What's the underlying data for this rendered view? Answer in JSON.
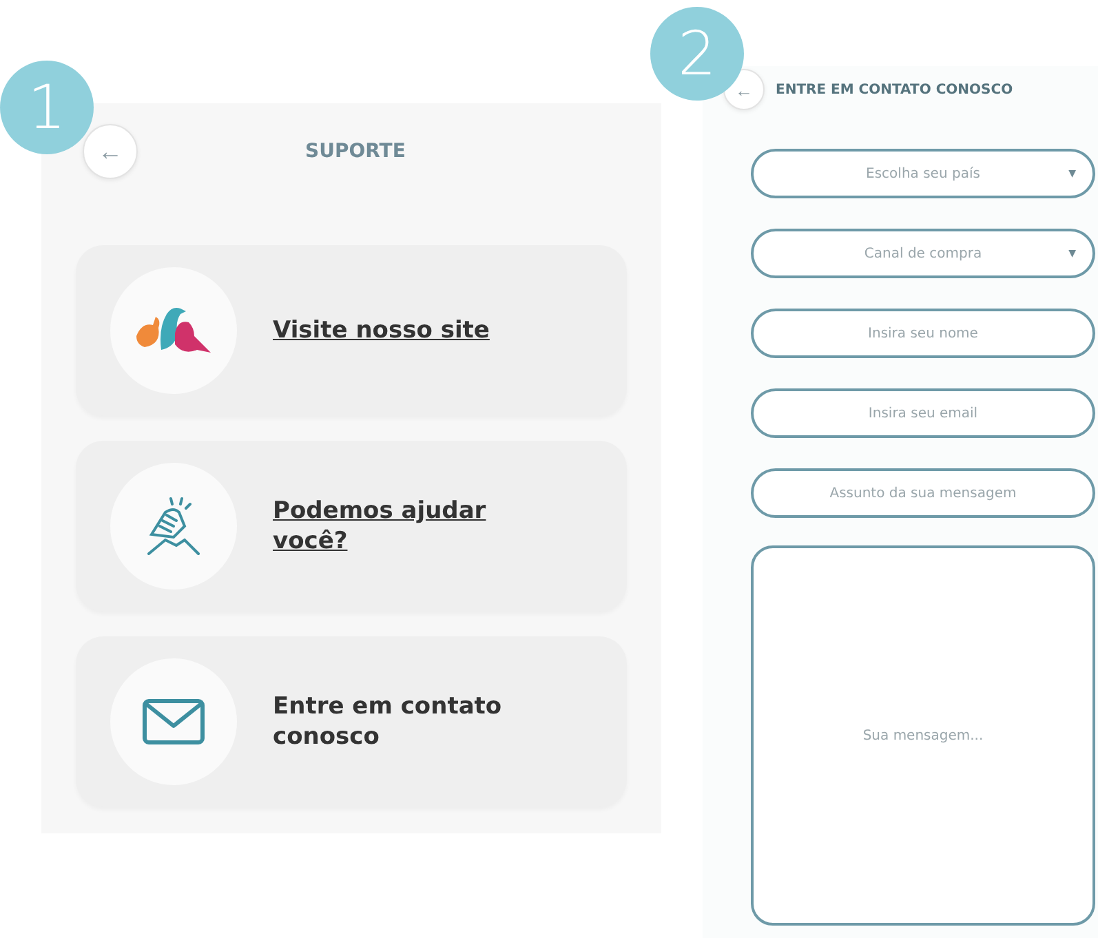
{
  "steps": [
    "1",
    "2"
  ],
  "support": {
    "back": "←",
    "title": "SUPORTE",
    "cards": [
      {
        "label": "Visite nosso site",
        "kind": "link"
      },
      {
        "label": "Podemos ajudar você?",
        "kind": "link"
      },
      {
        "label": "Entre em contato conosco",
        "kind": "text"
      }
    ]
  },
  "contact": {
    "back": "←",
    "title": "ENTRE EM CONTATO CONOSCO",
    "fields": [
      {
        "kind": "select",
        "placeholder": "Escolha seu país",
        "caret": "▼"
      },
      {
        "kind": "select",
        "placeholder": "Canal de compra",
        "caret": "▼"
      },
      {
        "kind": "text",
        "placeholder": "Insira seu nome"
      },
      {
        "kind": "text",
        "placeholder": "Insira seu email"
      },
      {
        "kind": "text",
        "placeholder": "Assunto da sua mensagem"
      }
    ],
    "message": {
      "placeholder": "Sua mensagem..."
    }
  }
}
